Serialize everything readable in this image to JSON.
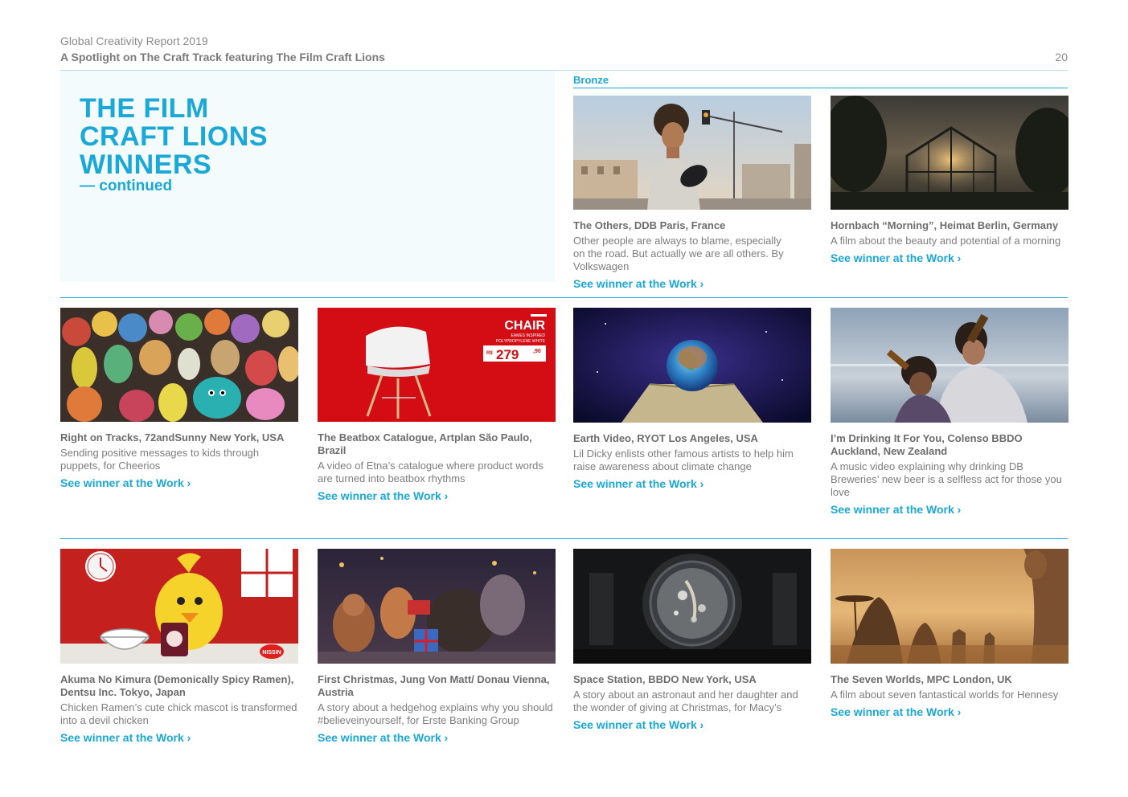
{
  "header": {
    "title": "Global Creativity Report 2019",
    "subtitle": "A Spotlight on The Craft Track featuring The Film Craft Lions",
    "page_number": "20"
  },
  "hero": {
    "line1": "THE FILM",
    "line2": "CRAFT LIONS",
    "line3": "WINNERS",
    "continued": "— continued"
  },
  "section_label": "Bronze",
  "link_label": "See winner at the Work ›",
  "cards": [
    {
      "title": "The Others, DDB Paris, France",
      "desc": "Other people are always to blame, especially on the road. But actually we are all others. By Volkswagen"
    },
    {
      "title": "Hornbach “Morning”, Heimat Berlin, Germany",
      "desc": "A film about the beauty and potential of a morning"
    },
    {
      "title": "Right on Tracks, 72andSunny New York, USA",
      "desc": "Sending positive messages to kids through puppets, for Cheerios"
    },
    {
      "title": "The Beatbox Catalogue, Artplan São Paulo, Brazil",
      "desc": "A video of Etna’s catalogue where product words are turned into beatbox rhythms"
    },
    {
      "title": "Earth Video, RYOT Los Angeles, USA",
      "desc": "Lil Dicky enlists other famous artists to help him raise awareness about climate change"
    },
    {
      "title": "I’m Drinking It For You, Colenso BBDO Auckland, New Zealand",
      "desc": "A music video explaining why drinking DB Breweries’ new beer is a selfless act for those you love"
    },
    {
      "title": "Akuma No Kimura (Demonically Spicy Ramen), Dentsu Inc. Tokyo, Japan",
      "desc": "Chicken Ramen’s cute chick mascot is transformed into a devil chicken"
    },
    {
      "title": "First Christmas, Jung Von Matt/ Donau Vienna, Austria",
      "desc": "A story about a hedgehog explains why you should #believeinyourself, for Erste Banking Group"
    },
    {
      "title": "Space Station, BBDO New York, USA",
      "desc": "A story about an astronaut and her daughter and the wonder of giving at Christmas, for Macy’s"
    },
    {
      "title": "The Seven Worlds, MPC London, UK",
      "desc": "A film about seven fantastical worlds for Hennesy"
    }
  ],
  "chair_ad": {
    "word": "CHAIR",
    "sub1": "EAMES INSPIRED",
    "sub2": "POLYPROPYLENE WHITE",
    "currency": "R$",
    "price": "279",
    "cents": ",90"
  },
  "nissin": "NISSIN",
  "colors": {
    "accent": "#1aa8d8",
    "hero_bg": "#f3fbfd",
    "text": "#6d6d6d"
  }
}
